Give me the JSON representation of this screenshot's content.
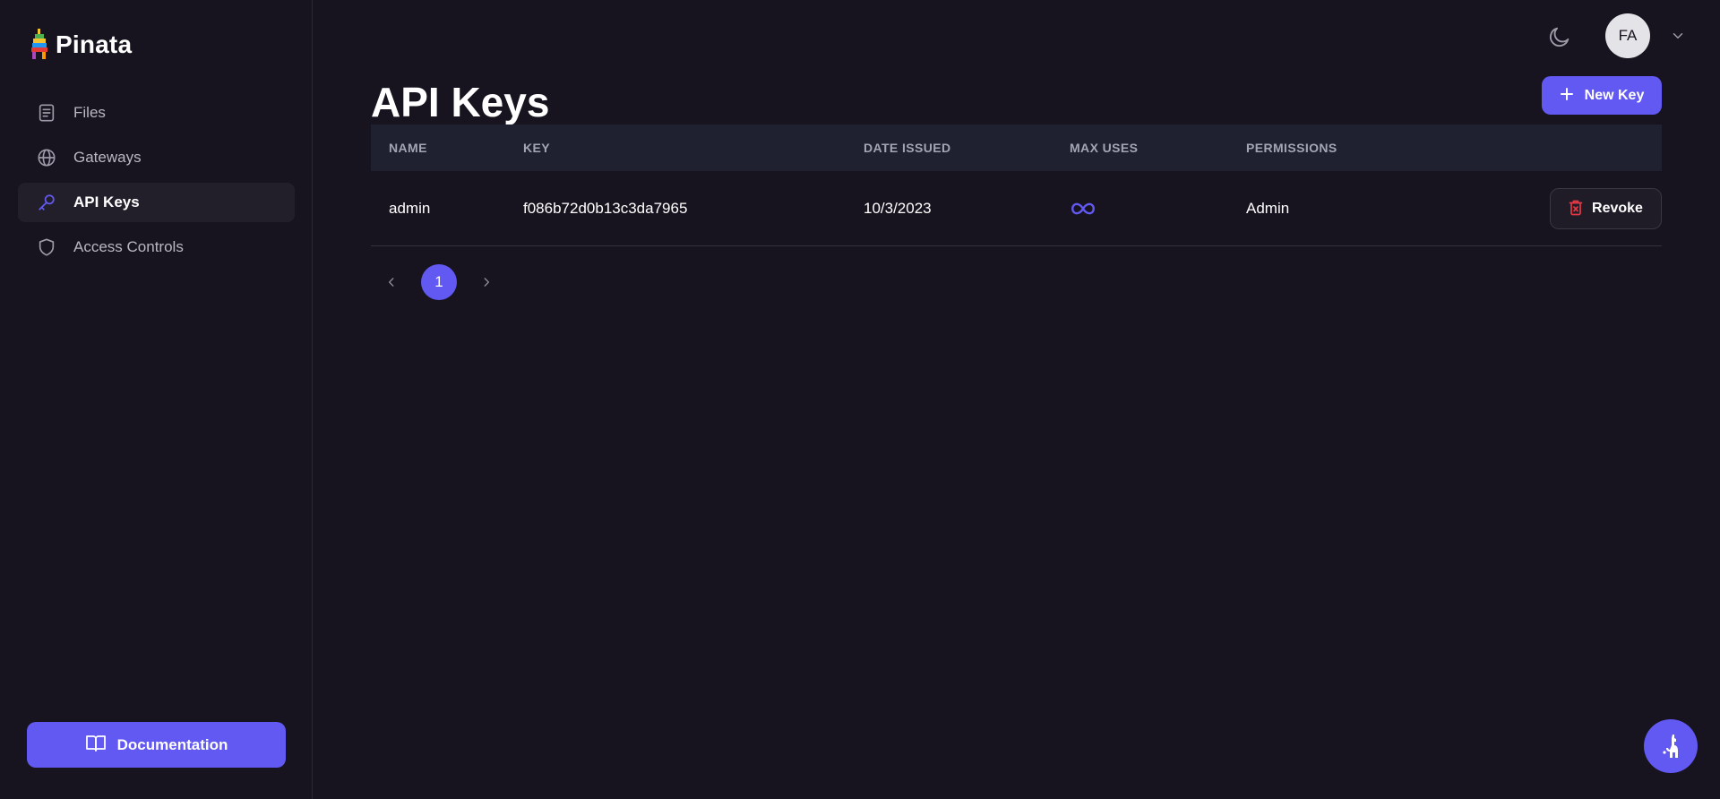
{
  "brand": {
    "name": "Pinata",
    "accent": "#6259f2"
  },
  "sidebar": {
    "items": [
      {
        "label": "Files",
        "icon": "file-icon",
        "active": false
      },
      {
        "label": "Gateways",
        "icon": "globe-icon",
        "active": false
      },
      {
        "label": "API Keys",
        "icon": "key-icon",
        "active": true
      },
      {
        "label": "Access Controls",
        "icon": "shield-icon",
        "active": false
      }
    ],
    "documentation_label": "Documentation"
  },
  "header": {
    "theme_toggle_icon": "moon-icon",
    "avatar_initials": "FA",
    "menu_icon": "chevron-down-icon"
  },
  "main": {
    "title": "API Keys",
    "new_key_label": "New Key",
    "table": {
      "columns": [
        "NAME",
        "KEY",
        "DATE ISSUED",
        "MAX USES",
        "PERMISSIONS"
      ],
      "rows": [
        {
          "name": "admin",
          "key": "f086b72d0b13c3da7965",
          "date_issued": "10/3/2023",
          "max_uses_icon": "infinity-icon",
          "permissions": "Admin",
          "action_label": "Revoke"
        }
      ]
    },
    "pagination": {
      "current_page": "1"
    }
  },
  "help_fab_icon": "llama-icon"
}
